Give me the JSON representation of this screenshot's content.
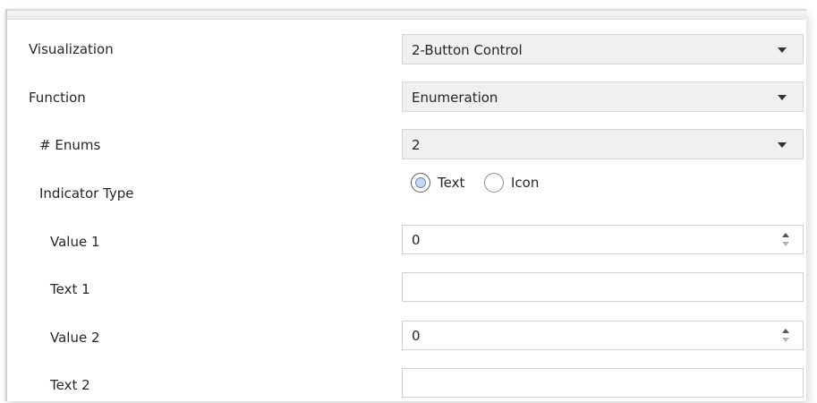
{
  "rows": {
    "visualization": {
      "label": "Visualization",
      "value": "2-Button Control"
    },
    "function": {
      "label": "Function",
      "value": "Enumeration"
    },
    "enums": {
      "label": "# Enums",
      "value": "2"
    },
    "indicator_type": {
      "label": "Indicator Type",
      "options": [
        {
          "label": "Text",
          "selected": true
        },
        {
          "label": "Icon",
          "selected": false
        }
      ]
    },
    "value1": {
      "label": "Value 1",
      "value": "0"
    },
    "text1": {
      "label": "Text 1",
      "value": ""
    },
    "value2": {
      "label": "Value 2",
      "value": "0"
    },
    "text2": {
      "label": "Text 2",
      "value": ""
    }
  },
  "icons": {
    "dropdown": "chevron-down-icon",
    "spinner_up": "arrow-up-icon",
    "spinner_down": "arrow-down-icon"
  }
}
